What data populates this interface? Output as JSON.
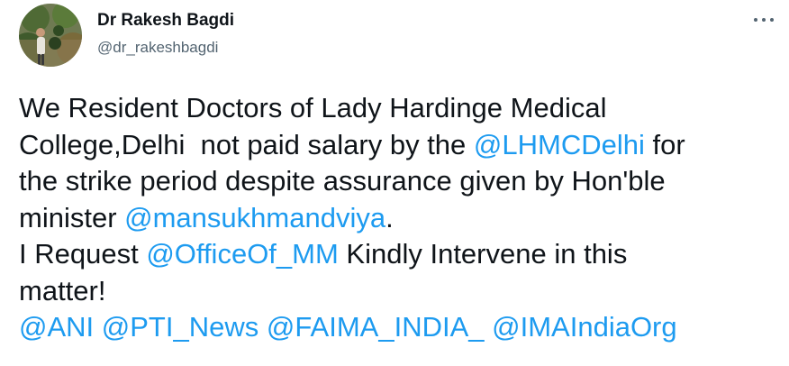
{
  "author": {
    "display_name": "Dr Rakesh Bagdi",
    "handle": "@dr_rakeshbagdi",
    "avatar_icon": "profile-photo"
  },
  "menu_icon": "more-options-icon",
  "colors": {
    "text": "#0f1419",
    "secondary": "#536471",
    "link": "#1d9bf0"
  },
  "tweet": {
    "t1": "We Resident Doctors of Lady Hardinge Medical\nCollege,Delhi  not paid salary by the ",
    "m1": "@LHMCDelhi",
    "t2": " for\nthe strike period despite assurance given by Hon'ble\nminister ",
    "m2": "@mansukhmandviya",
    "t3": ".\nI Request ",
    "m3": "@OfficeOf_MM",
    "t4": " Kindly Intervene in this\nmatter!\n",
    "m4": "@ANI",
    "s1": " ",
    "m5": "@PTI_News",
    "s2": " ",
    "m6": "@FAIMA_INDIA_",
    "s3": " ",
    "m7": "@IMAIndiaOrg"
  }
}
